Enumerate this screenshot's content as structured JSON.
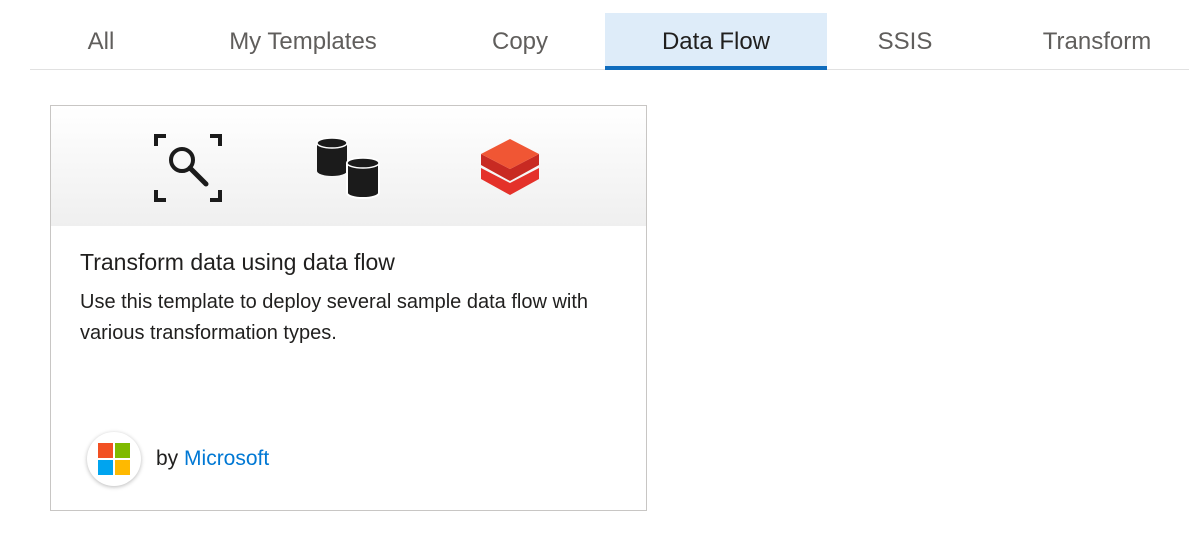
{
  "tabs": [
    {
      "label": "All",
      "active": false
    },
    {
      "label": "My Templates",
      "active": false
    },
    {
      "label": "Copy",
      "active": false
    },
    {
      "label": "Data Flow",
      "active": true
    },
    {
      "label": "SSIS",
      "active": false
    },
    {
      "label": "Transform",
      "active": false
    }
  ],
  "accent_color": "#0f6cbd",
  "active_tab_bg": "#deecf9",
  "card": {
    "icons": [
      "search-scan-icon",
      "database-icon",
      "databricks-icon"
    ],
    "title": "Transform data using data flow",
    "description": "Use this template to deploy several sample data flow with various transformation types.",
    "publisher_prefix": "by",
    "publisher_name": "Microsoft",
    "publisher_logo": "microsoft-logo-icon"
  }
}
